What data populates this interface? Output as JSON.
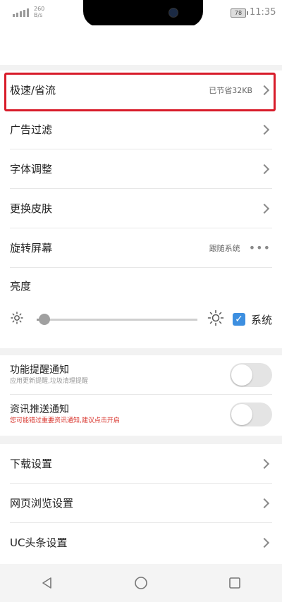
{
  "status_bar": {
    "net_speed_value": "260",
    "net_speed_unit": "B/s",
    "battery": "78",
    "time": "11:35"
  },
  "settings_group_1": [
    {
      "label": "极速/省流",
      "value": "已节省32KB",
      "trailing": "chevron-right-icon"
    },
    {
      "label": "广告过滤",
      "value": "",
      "trailing": "chevron-right-icon"
    },
    {
      "label": "字体调整",
      "value": "",
      "trailing": "chevron-right-icon"
    },
    {
      "label": "更换皮肤",
      "value": "",
      "trailing": "chevron-right-icon"
    },
    {
      "label": "旋转屏幕",
      "value": "跟随系统",
      "trailing": "more-dots-icon"
    }
  ],
  "brightness": {
    "label": "亮度",
    "level": 0.05,
    "system_checked": true,
    "system_label": "系统"
  },
  "notifications": [
    {
      "title": "功能提醒通知",
      "subtitle": "应用更新提醒,垃圾清理提醒",
      "enabled": false
    },
    {
      "title": "资讯推送通知",
      "subtitle": "您可能错过重要资讯通知,建议点击开启",
      "enabled": false
    }
  ],
  "settings_group_3": [
    {
      "label": "下载设置"
    },
    {
      "label": "网页浏览设置"
    },
    {
      "label": "UC头条设置"
    }
  ],
  "colors": {
    "highlight": "#d81c2a",
    "accent": "#3d8fe0",
    "warning_text": "#d8342c"
  }
}
